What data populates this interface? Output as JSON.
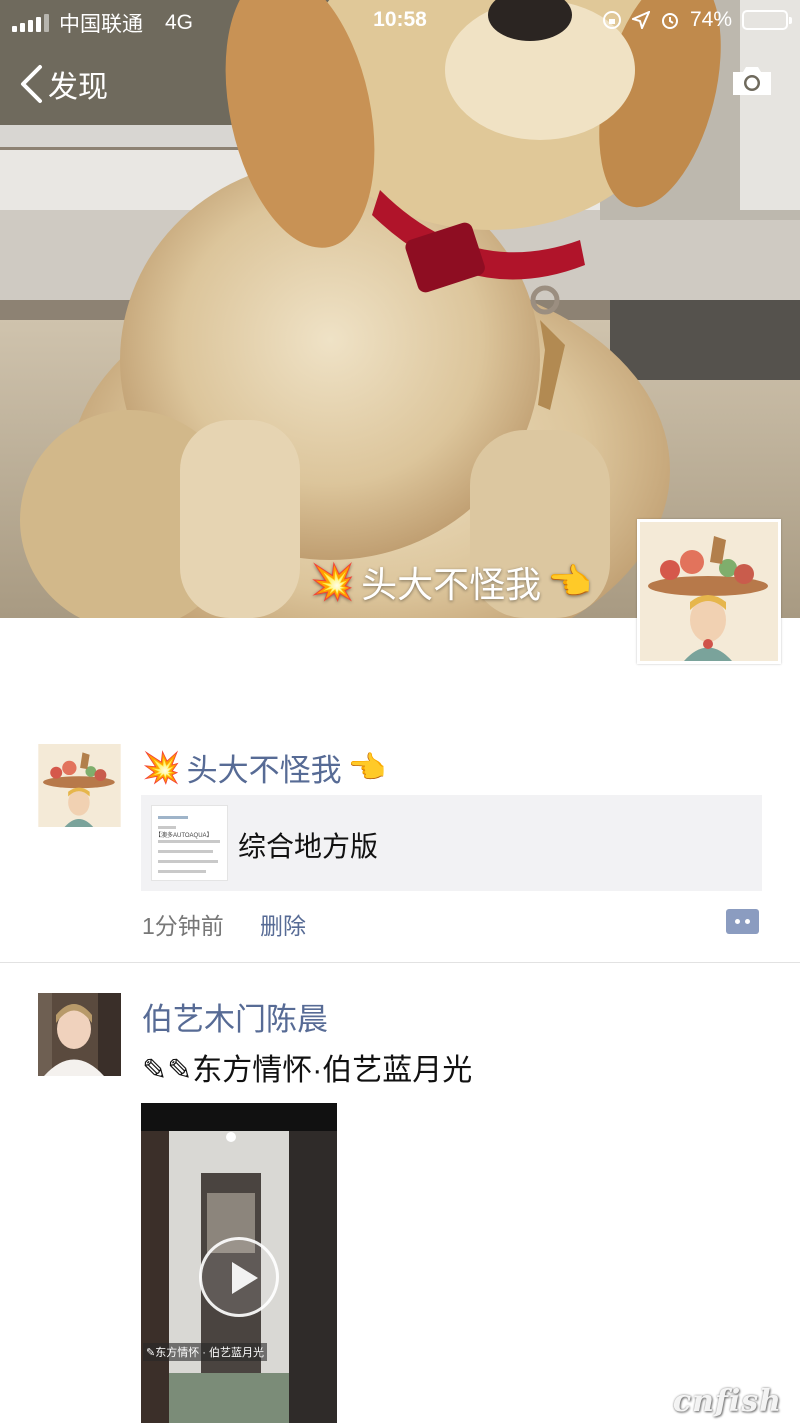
{
  "status_bar": {
    "carrier": "中国联通",
    "network": "4G",
    "time": "10:58",
    "battery": "74%",
    "battery_level": 0.74
  },
  "nav": {
    "back_label": "发现"
  },
  "profile": {
    "name": "头大不怪我",
    "name_prefix_emoji": "💥",
    "name_suffix_emoji": "👈"
  },
  "posts": [
    {
      "author": "头大不怪我",
      "author_prefix_emoji": "💥",
      "author_suffix_emoji": "👈",
      "share": {
        "thumb_brand": "【澳多AUTOAQUA】",
        "title": "综合地方版"
      },
      "time": "1分钟前",
      "delete_label": "删除"
    },
    {
      "author": "伯艺木门陈晨",
      "text": "✎✎东方情怀·伯艺蓝月光",
      "video_caption": "✎东方情怀 · 伯艺蓝月光"
    }
  ],
  "watermark": "cnfish",
  "colors": {
    "link": "#576b95",
    "card_bg": "#f2f2f4",
    "comment_button": "#8b9cc0"
  },
  "icons": [
    "signal-icon",
    "back-chevron-icon",
    "camera-icon",
    "location-icon",
    "alarm-icon",
    "battery-icon",
    "comment-icon",
    "play-icon"
  ]
}
